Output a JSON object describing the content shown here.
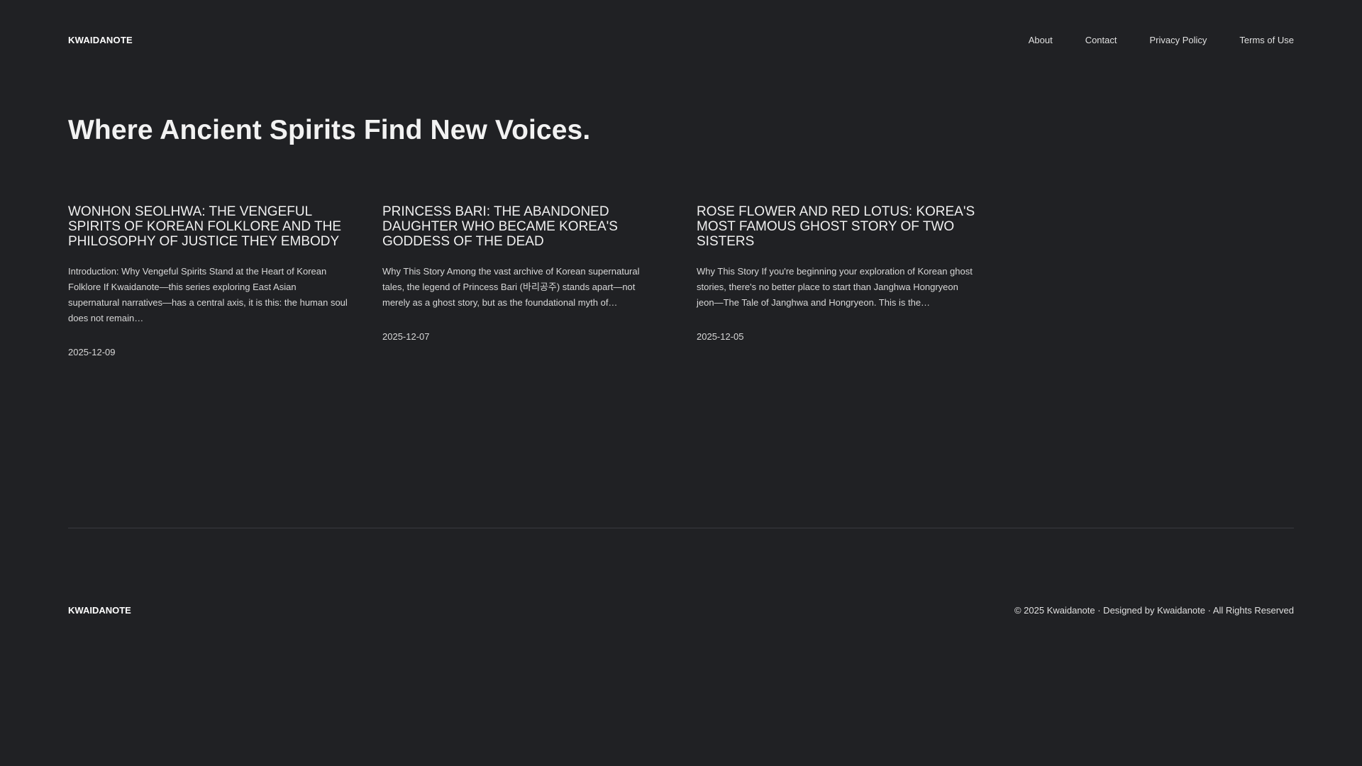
{
  "header": {
    "brand": "KWAIDANOTE",
    "nav": [
      {
        "label": "About"
      },
      {
        "label": "Contact"
      },
      {
        "label": "Privacy Policy"
      },
      {
        "label": "Terms of Use"
      }
    ]
  },
  "hero": {
    "title": "Where Ancient Spirits Find New Voices."
  },
  "posts": [
    {
      "title": "WONHON SEOLHWA: THE VENGEFUL SPIRITS OF KOREAN FOLKLORE AND THE PHILOSOPHY OF JUSTICE THEY EMBODY",
      "excerpt": "Introduction: Why Vengeful Spirits Stand at the Heart of Korean Folklore If Kwaidanote—this series exploring East Asian supernatural narratives—has a central axis, it is this: the human soul does not remain…",
      "date": "2025-12-09"
    },
    {
      "title": "PRINCESS BARI: THE ABANDONED DAUGHTER WHO BECAME KOREA'S GODDESS OF THE DEAD",
      "excerpt": "Why This Story Among the vast archive of Korean supernatural tales, the legend of Princess Bari (바리공주) stands apart—not merely as a ghost story, but as the foundational myth of…",
      "date": "2025-12-07"
    },
    {
      "title": "ROSE FLOWER AND RED LOTUS: KOREA'S MOST FAMOUS GHOST STORY OF TWO SISTERS",
      "excerpt": "Why This Story If you're beginning your exploration of Korean ghost stories, there's no better place to start than Janghwa Hongryeon jeon—The Tale of Janghwa and Hongryeon. This is the…",
      "date": "2025-12-05"
    }
  ],
  "footer": {
    "brand": "KWAIDANOTE",
    "copyright": "© 2025 Kwaidanote · Designed by Kwaidanote · All Rights Reserved"
  },
  "colors": {
    "background": "#202124",
    "text": "#e8e8e8",
    "divider": "#3a3b3f"
  }
}
